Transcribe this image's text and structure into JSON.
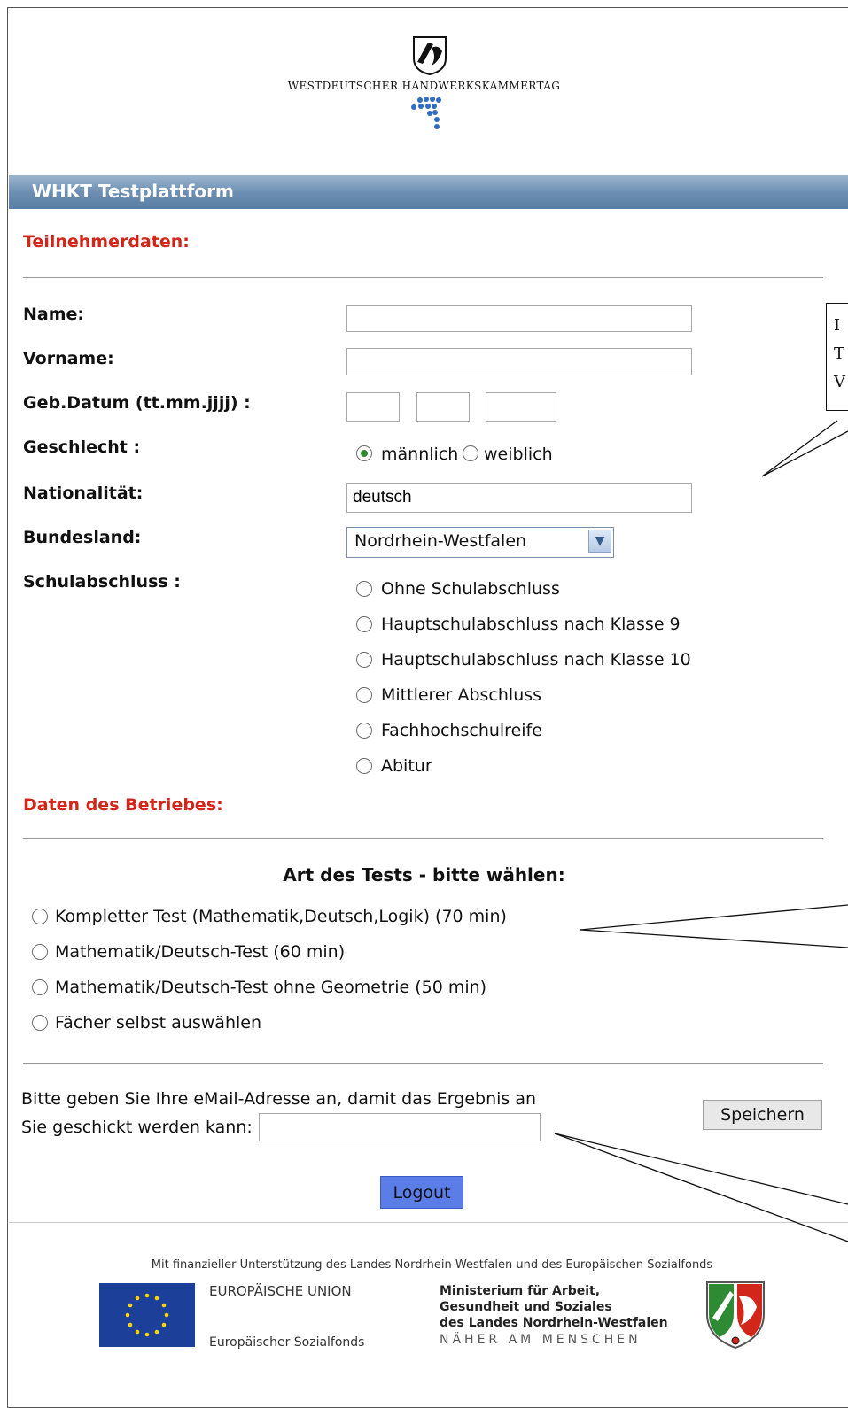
{
  "header": {
    "brand_text": "WESTDEUTSCHER HANDWERKSKAMMERTAG",
    "bar_title": "WHKT Testplattform"
  },
  "participant": {
    "section_title": "Teilnehmerdaten:",
    "name_label": "Name:",
    "name_value": "",
    "vorname_label": "Vorname:",
    "vorname_value": "",
    "geb_label": "Geb.Datum (tt.mm.jjjj) :",
    "day_value": "",
    "month_value": "",
    "year_value": "",
    "gender_label": "Geschlecht :",
    "gender_options": [
      "männlich",
      "weiblich"
    ],
    "gender_selected": "männlich",
    "nationality_label": "Nationalität:",
    "nationality_value": "deutsch",
    "state_label": "Bundesland:",
    "state_value": "Nordrhein-Westfalen",
    "school_label": "Schulabschluss :",
    "school_options": [
      "Ohne Schulabschluss",
      "Hauptschulabschluss nach Klasse 9",
      "Hauptschulabschluss nach Klasse 10",
      "Mittlerer Abschluss",
      "Fachhochschulreife",
      "Abitur"
    ]
  },
  "company": {
    "section_title": "Daten des Betriebes:"
  },
  "test_type": {
    "heading": "Art des Tests - bitte wählen:",
    "options": [
      "Kompletter Test (Mathematik,Deutsch,Logik) (70 min)",
      "Mathematik/Deutsch-Test (60 min)",
      "Mathematik/Deutsch-Test ohne Geometrie (50 min)",
      "Fächer selbst auswählen"
    ]
  },
  "email": {
    "text_line1": "Bitte geben Sie Ihre eMail-Adresse an, damit das Ergebnis an",
    "text_line2": "Sie geschickt werden kann:",
    "value": "",
    "save_label": "Speichern"
  },
  "logout_label": "Logout",
  "callout": {
    "line1": "I",
    "line2": "T",
    "line3": "V"
  },
  "footer": {
    "funding_text": "Mit finanzieller Unterstützung des Landes Nordrhein-Westfalen und des Europäischen Sozialfonds",
    "eu_title": "EUROPÄISCHE UNION",
    "eu_sub": "Europäischer Sozialfonds",
    "ministry_line1": "Ministerium für Arbeit,",
    "ministry_line2": "Gesundheit und Soziales",
    "ministry_line3": "des Landes Nordrhein-Westfalen",
    "ministry_line4": "NÄHER AM MENSCHEN"
  },
  "colors": {
    "accent_red": "#d3261b",
    "bar_blue": "#6d8fb3",
    "logout_blue": "#5b7de8",
    "eu_blue": "#1c3f99",
    "eu_star": "#ffd400"
  }
}
